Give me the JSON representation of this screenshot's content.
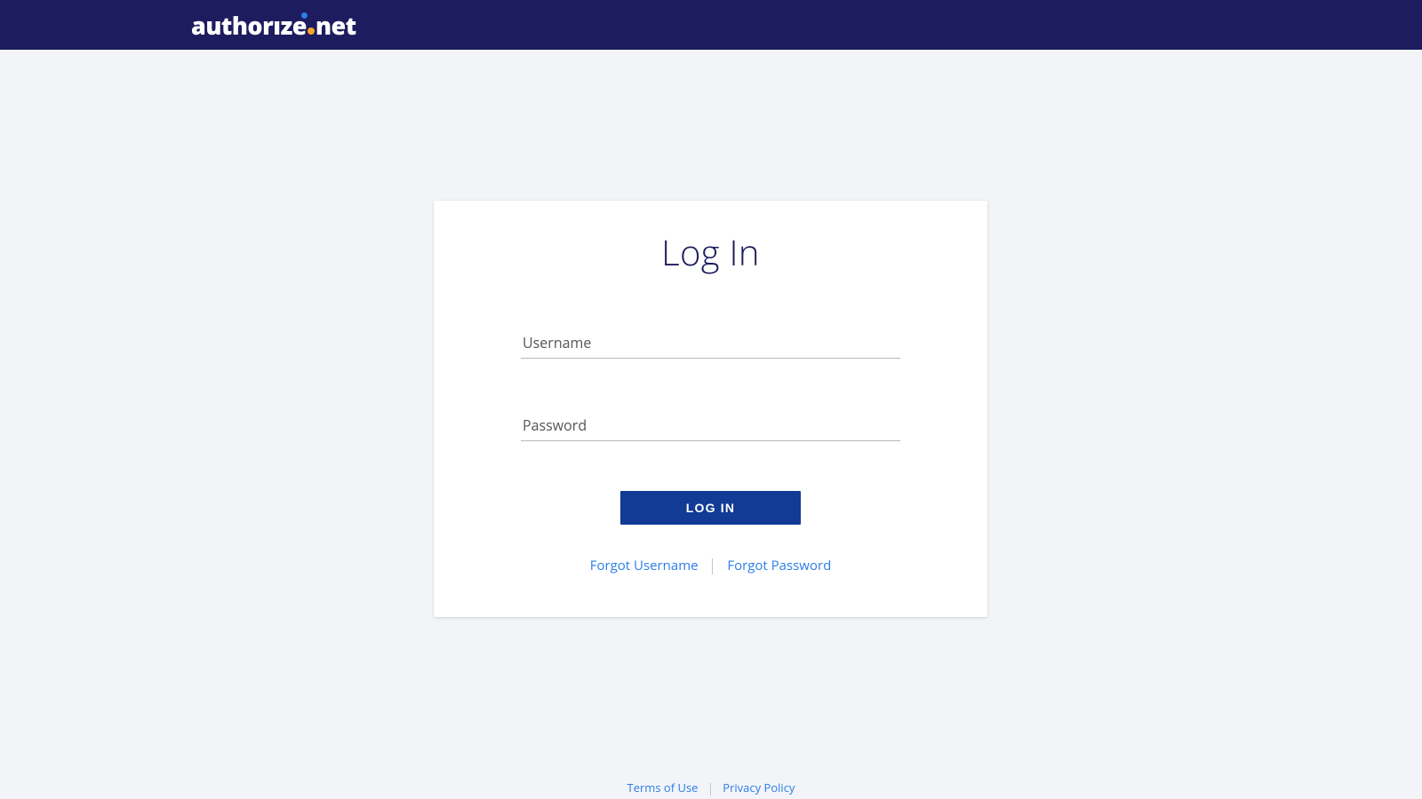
{
  "header": {
    "logo_text_left": "author",
    "logo_text_i": "ı",
    "logo_text_mid": "ze",
    "logo_text_right": "net"
  },
  "card": {
    "title": "Log In",
    "username_label": "Username",
    "username_value": "",
    "password_label": "Password",
    "password_value": "",
    "login_button": "LOG IN",
    "forgot_username": "Forgot Username",
    "forgot_password": "Forgot Password"
  },
  "footer": {
    "terms": "Terms of Use",
    "privacy": "Privacy Policy"
  }
}
